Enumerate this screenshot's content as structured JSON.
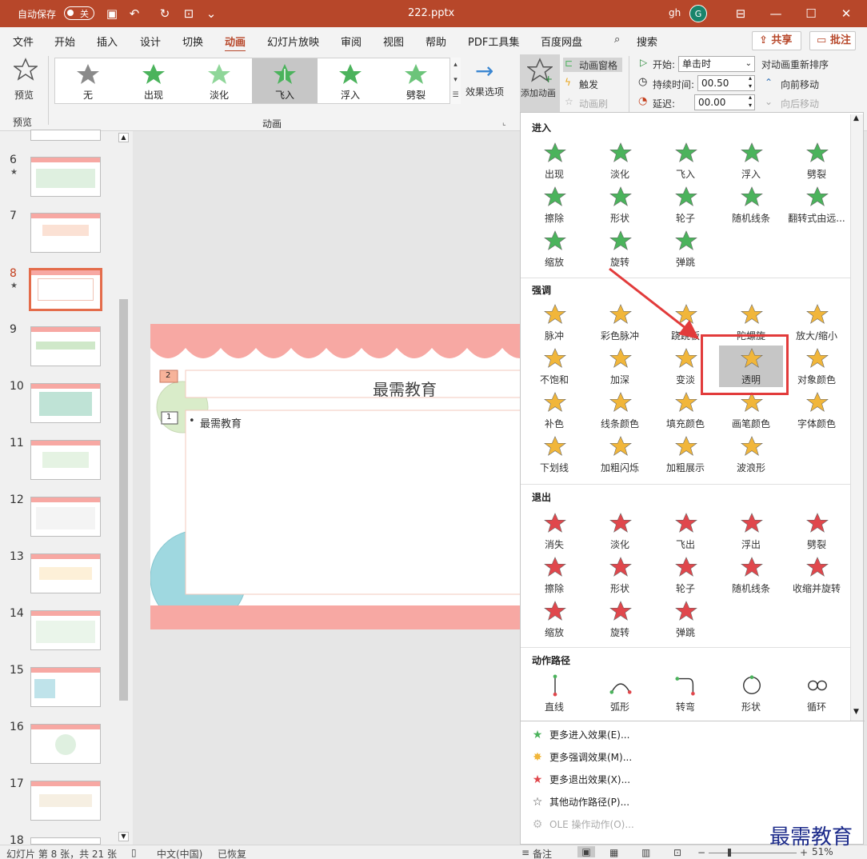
{
  "titlebar": {
    "autosave_label": "自动保存",
    "autosave_state": "关",
    "filename": "222.pptx",
    "user": "gh",
    "avatar_letter": "G"
  },
  "menu": {
    "items": [
      "文件",
      "开始",
      "插入",
      "设计",
      "切换",
      "动画",
      "幻灯片放映",
      "审阅",
      "视图",
      "帮助",
      "PDF工具集",
      "百度网盘"
    ],
    "search": "搜索",
    "share": "共享",
    "comment": "批注"
  },
  "ribbon": {
    "preview": "预览",
    "preview_group": "预览",
    "animation_group": "动画",
    "gallery": [
      {
        "label": "无",
        "color": "#8a8a8a"
      },
      {
        "label": "出现",
        "color": "#4bb35c"
      },
      {
        "label": "淡化",
        "color": "#7dcf86"
      },
      {
        "label": "飞入",
        "color": "#4bb35c"
      },
      {
        "label": "浮入",
        "color": "#4bb35c"
      },
      {
        "label": "劈裂",
        "color": "#6cc47a"
      }
    ],
    "effect_options": "效果选项",
    "add_animation": "添加动画",
    "anim_pane": "动画窗格",
    "trigger": "触发",
    "anim_painter": "动画刷",
    "start_label": "开始:",
    "start_value": "单击时",
    "duration_label": "持续时间:",
    "duration_value": "00.50",
    "delay_label": "延迟:",
    "delay_value": "00.00",
    "reorder": "对动画重新排序",
    "move_earlier": "向前移动",
    "move_later": "向后移动"
  },
  "slides": {
    "numbers": [
      "6",
      "7",
      "8",
      "9",
      "10",
      "11",
      "12",
      "13",
      "14",
      "15",
      "16",
      "17",
      "18"
    ],
    "current": "8"
  },
  "slide": {
    "title": "最需教育",
    "bullet": "最需教育",
    "tag1": "2",
    "tag2": "1"
  },
  "panel": {
    "entrance_header": "进入",
    "entrance": [
      "出现",
      "淡化",
      "飞入",
      "浮入",
      "劈裂",
      "擦除",
      "形状",
      "轮子",
      "随机线条",
      "翻转式由远...",
      "缩放",
      "旋转",
      "弹跳"
    ],
    "emphasis_header": "强调",
    "emphasis": [
      "脉冲",
      "彩色脉冲",
      "跷跷板",
      "陀螺旋",
      "放大/缩小",
      "不饱和",
      "加深",
      "变淡",
      "透明",
      "对象颜色",
      "补色",
      "线条颜色",
      "填充颜色",
      "画笔颜色",
      "字体颜色",
      "下划线",
      "加粗闪烁",
      "加粗展示",
      "波浪形"
    ],
    "exit_header": "退出",
    "exit": [
      "消失",
      "淡化",
      "飞出",
      "浮出",
      "劈裂",
      "擦除",
      "形状",
      "轮子",
      "随机线条",
      "收缩并旋转",
      "缩放",
      "旋转",
      "弹跳"
    ],
    "path_header": "动作路径",
    "paths": [
      "直线",
      "弧形",
      "转弯",
      "形状",
      "循环"
    ],
    "more": [
      "更多进入效果(E)...",
      "更多强调效果(M)...",
      "更多退出效果(X)...",
      "其他动作路径(P)...",
      "OLE 操作动作(O)..."
    ],
    "colors": {
      "entrance": "#4bb35c",
      "emphasis": "#f1b63a",
      "exit": "#e0474c"
    }
  },
  "status": {
    "slide_info": "幻灯片 第 8 张，共 21 张",
    "language": "中文(中国)",
    "recovered": "已恢复",
    "notes": "备注",
    "zoom": "51%"
  },
  "watermark": "最需教育"
}
